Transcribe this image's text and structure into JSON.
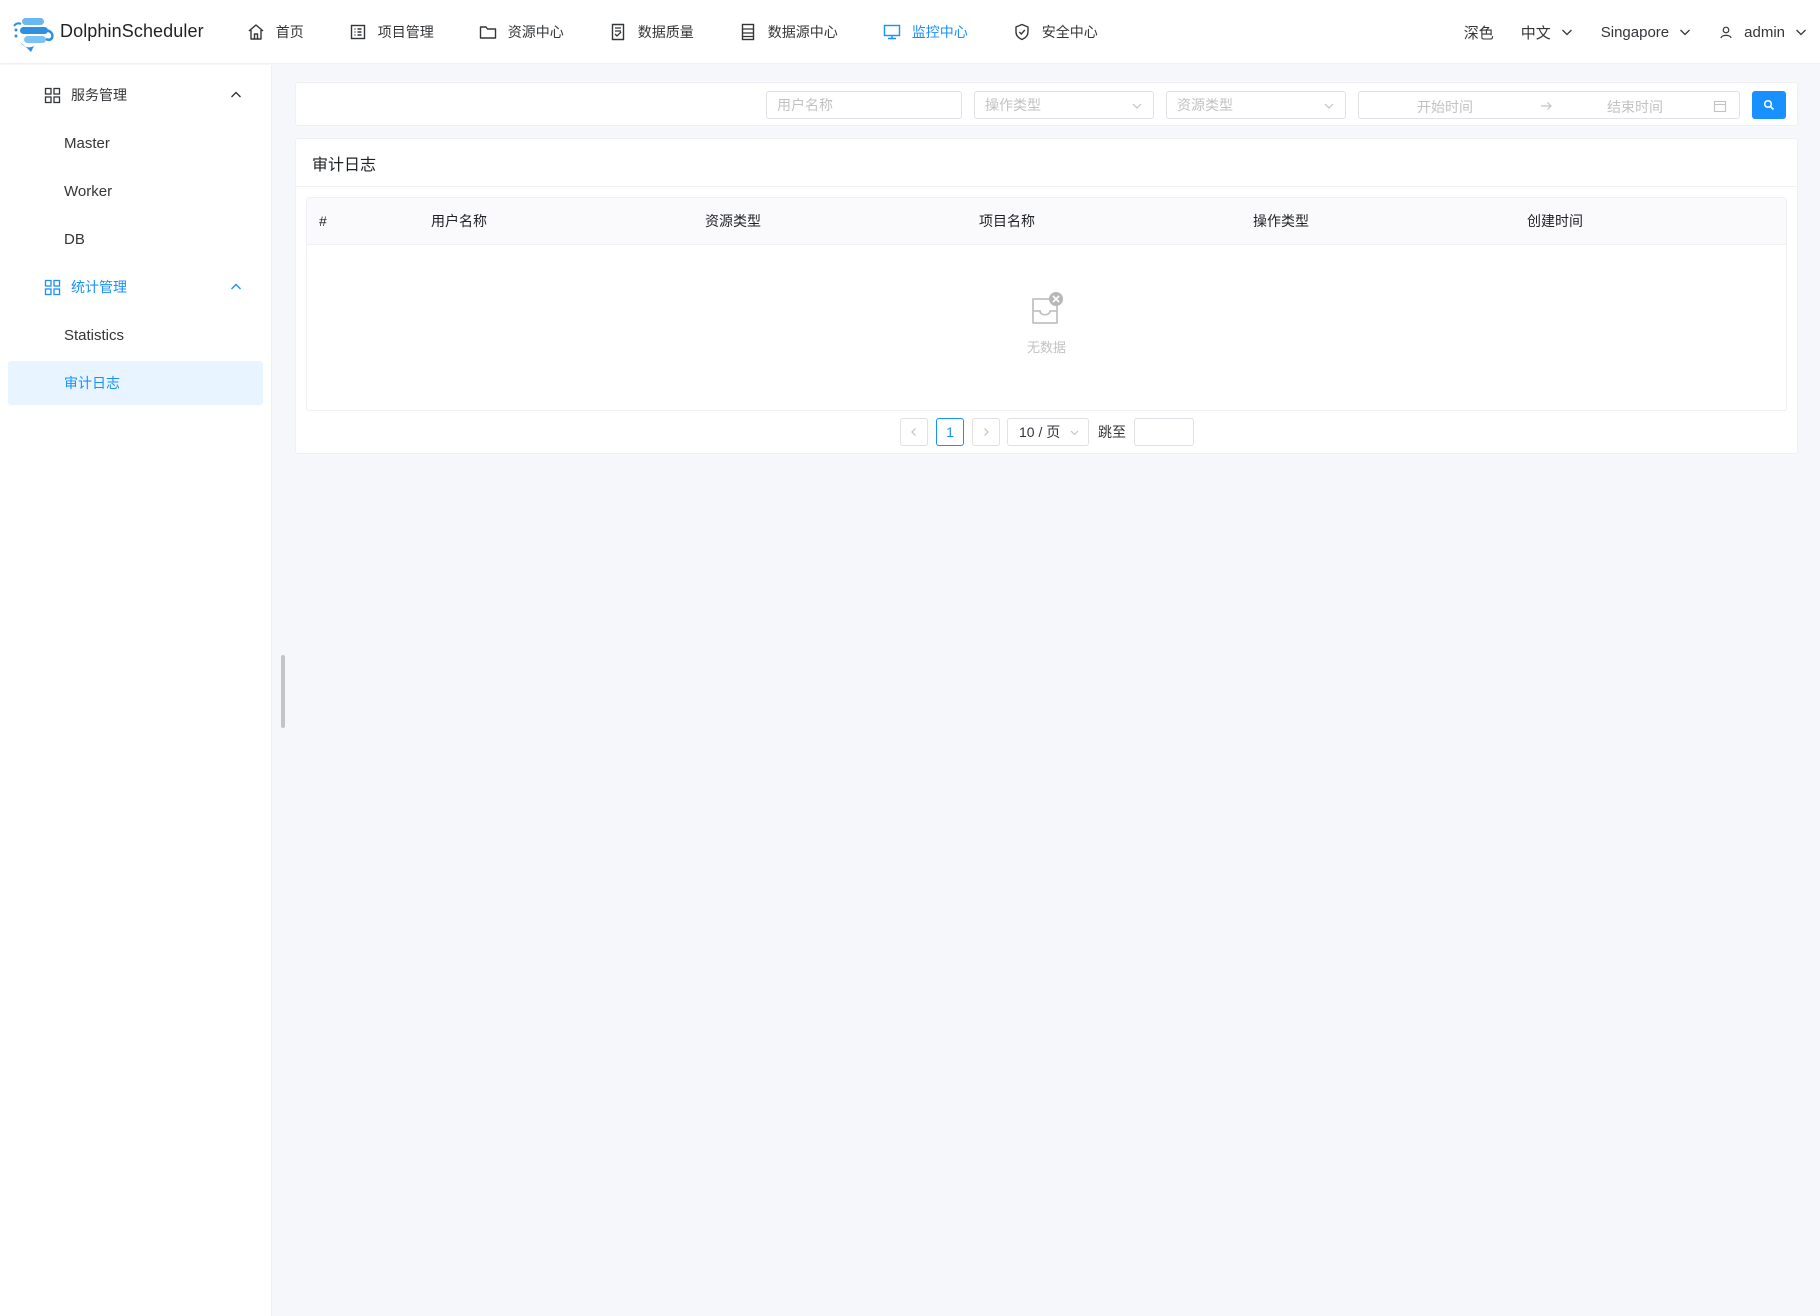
{
  "app": {
    "name": "DolphinScheduler"
  },
  "nav": {
    "items": [
      {
        "label": "首页",
        "icon": "home-icon"
      },
      {
        "label": "项目管理",
        "icon": "project-icon"
      },
      {
        "label": "资源中心",
        "icon": "folder-icon"
      },
      {
        "label": "数据质量",
        "icon": "data-quality-icon"
      },
      {
        "label": "数据源中心",
        "icon": "datasource-icon"
      },
      {
        "label": "监控中心",
        "icon": "monitor-icon",
        "active": true
      },
      {
        "label": "安全中心",
        "icon": "shield-icon"
      }
    ],
    "theme": "深色",
    "language": "中文",
    "timezone": "Singapore",
    "user": "admin"
  },
  "sidebar": {
    "groups": [
      {
        "label": "服务管理",
        "items": [
          "Master",
          "Worker",
          "DB"
        ]
      },
      {
        "label": "统计管理",
        "items": [
          "Statistics",
          "审计日志"
        ],
        "active_item": "审计日志"
      }
    ]
  },
  "search": {
    "user_placeholder": "用户名称",
    "op_placeholder": "操作类型",
    "res_placeholder": "资源类型",
    "start_placeholder": "开始时间",
    "end_placeholder": "结束时间"
  },
  "card": {
    "title": "审计日志",
    "columns": [
      "#",
      "用户名称",
      "资源类型",
      "项目名称",
      "操作类型",
      "创建时间"
    ],
    "rows": [],
    "empty_text": "无数据"
  },
  "pagination": {
    "current_page": "1",
    "page_size": "10 / 页",
    "jump_label": "跳至"
  },
  "colors": {
    "accent": "#1890ff",
    "active_bg": "#e8f4ff",
    "page_bg": "#f6f7fb"
  }
}
